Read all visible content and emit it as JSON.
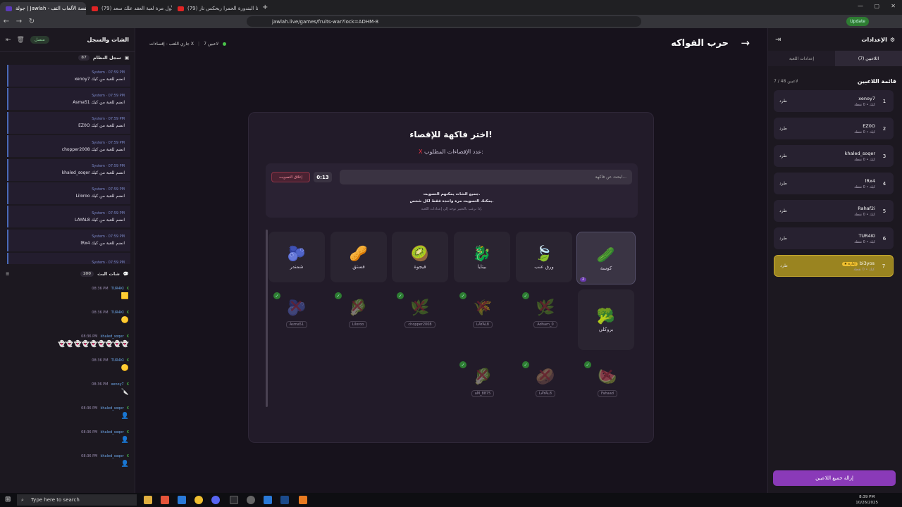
{
  "browser": {
    "tabs": [
      {
        "label": "جولة | Jawlah - منصة الألعاب التف"
      },
      {
        "label": "(79) لأول مرة لعبة العقد علك سعد"
      },
      {
        "label": "(79) انا البندورة الحمرا ربحكس نار"
      }
    ],
    "url": "jawlah.live/games/fruits-war?lock=ADHM-8",
    "update_label": "Update"
  },
  "left": {
    "title": "الشات والسجل",
    "status": "متصل",
    "syslog_title": "سجل النظام",
    "syslog_count": "87",
    "syslog": [
      {
        "meta": "System · 07:59 PM",
        "text": "xenoy7 انضم للعبة من كيك"
      },
      {
        "meta": "System · 07:59 PM",
        "text": "Asma51 انضم للعبة من كيك"
      },
      {
        "meta": "System · 07:59 PM",
        "text": "EZ0O انضم للعبة من كيك"
      },
      {
        "meta": "System · 07:59 PM",
        "text": "chopper2008 انضم للعبة من كيك"
      },
      {
        "meta": "System · 07:59 PM",
        "text": "khaled_soqer انضم للعبة من كيك"
      },
      {
        "meta": "System · 07:59 PM",
        "text": "Liloroo انضم للعبة من كيك"
      },
      {
        "meta": "System · 07:59 PM",
        "text": "LAYAL8 انضم للعبة من كيك"
      },
      {
        "meta": "System · 07:59 PM",
        "text": "lRx4 انضم للعبة من كيك"
      },
      {
        "meta": "System · 07:59 PM",
        "text": ""
      }
    ],
    "chat_title": "شات البث",
    "chat_count": "100",
    "chat": [
      {
        "time": "08:36 PM",
        "name": "TUR4KI",
        "emoji": "🟨"
      },
      {
        "time": "08:36 PM",
        "name": "TUR4KI",
        "emoji": "🟡"
      },
      {
        "time": "08:36 PM",
        "name": "khaled_soqer",
        "emoji": "👻👻👻👻👻👻👻👻👻"
      },
      {
        "time": "08:36 PM",
        "name": "TUR4KI",
        "emoji": "🟡"
      },
      {
        "time": "08:36 PM",
        "name": "xenoy7",
        "emoji": "🔪"
      },
      {
        "time": "08:36 PM",
        "name": "khaled_soqer",
        "emoji": "👤"
      },
      {
        "time": "08:36 PM",
        "name": "khaled_soqer",
        "emoji": "👤"
      },
      {
        "time": "08:36 PM",
        "name": "khaled_soqer",
        "emoji": "👤"
      }
    ]
  },
  "game": {
    "title": "حرب الفواكه",
    "status": "جاري اللعب - إقصاءات X",
    "players_online": "7 لاعبين",
    "card_title": "اختر فاكهة للإقصاء!",
    "card_sub": "عدد الإقصاءات المطلوب:",
    "card_sub_value": "X",
    "search_placeholder": "ابحث عن فاكهة...",
    "timer": "0:13",
    "close_vote": "إغلاق التصويت",
    "note1": "جميع الشات يمكنهم التصويت.",
    "note2": "يمكنك التصويت مرة واحدة فقط لكل شخص.",
    "note3": "إذا ترغب بالتغيير توجه إلى إعدادات اللعبة.",
    "fruits": [
      {
        "name": "كوسة",
        "glyph": "🥒",
        "selected": true,
        "badge": "2"
      },
      {
        "name": "ورق عنب",
        "glyph": "🍃"
      },
      {
        "name": "بيتايا",
        "glyph": "🐉"
      },
      {
        "name": "فيجوة",
        "glyph": "🥝"
      },
      {
        "name": "فستق",
        "glyph": "🥜"
      },
      {
        "name": "شمندر",
        "glyph": "🫐"
      },
      {
        "name": "بروكلي",
        "glyph": "🥦"
      }
    ],
    "eliminated": [
      {
        "name": "Asma51",
        "glyph": "🫐"
      },
      {
        "name": "Liloroo",
        "glyph": "🥬"
      },
      {
        "name": "chopper2008",
        "glyph": "🌿"
      },
      {
        "name": "LAYAL8",
        "glyph": "🌾"
      },
      {
        "name": "Adham_0",
        "glyph": "🌿"
      },
      {
        "name": "Fahaad",
        "glyph": "🍉"
      },
      {
        "name": "LAYAL8",
        "glyph": "🥔"
      },
      {
        "name": "aM_8875",
        "glyph": "🥬"
      }
    ]
  },
  "right": {
    "title": "الإعدادات",
    "tab_players": "اللاعبين (7)",
    "tab_settings": "إعدادات اللعبة",
    "list_title": "قائمة اللاعبين",
    "list_count": "7 / 48 لاعبين",
    "kick": "طرد",
    "players": [
      {
        "num": "1",
        "name": "xenoy7",
        "sub": "كيك • 0 نقطة"
      },
      {
        "num": "2",
        "name": "EZ0O",
        "sub": "كيك • 0 نقطة"
      },
      {
        "num": "3",
        "name": "khaled_soqer",
        "sub": "كيك • 0 نقطة"
      },
      {
        "num": "4",
        "name": "lRx4",
        "sub": "كيك • 0 نقطة"
      },
      {
        "num": "5",
        "name": "Rahaf2i",
        "sub": "كيك • 0 نقطة"
      },
      {
        "num": "6",
        "name": "TUR4KI",
        "sub": "كيك • 0 نقطة"
      },
      {
        "num": "7",
        "name": "bi3yos",
        "sub": "كيك • 0 نقطة",
        "me": true,
        "badge": "★ إدارة"
      }
    ],
    "remove_all": "إزالة جميع اللاعبين"
  },
  "taskbar": {
    "search_placeholder": "Type here to search",
    "time": "8:39 PM",
    "date": "10/26/2025"
  },
  "colors": {
    "accent": "#8a3ab8",
    "gold": "#9a8420",
    "danger": "#e33344"
  }
}
